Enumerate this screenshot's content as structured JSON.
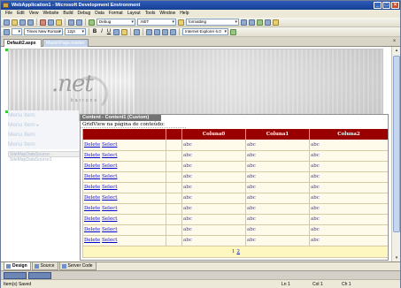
{
  "window": {
    "title": "WebApplication1 - Microsoft Development Environment"
  },
  "menu": [
    "File",
    "Edit",
    "View",
    "Website",
    "Build",
    "Debug",
    "Data",
    "Format",
    "Layout",
    "Tools",
    "Window",
    "Help"
  ],
  "toolbar": {
    "config": "Debug",
    "platform": ".NET",
    "find": "formatting",
    "font_name": "Times New Roman",
    "font_size": "12pt",
    "bold": "B",
    "italic": "I",
    "underline": "U",
    "target": "Internet Explorer 6.0"
  },
  "doc_tabs": {
    "active": "Default2.aspx",
    "inactive": "MasterPage.master"
  },
  "banner": {
    "logo": ".net",
    "logo_sub": "barrons"
  },
  "left_menu": {
    "items": [
      {
        "label": "Menu Item",
        "arrow": ""
      },
      {
        "label": "Menu Item",
        "arrow": "▸"
      },
      {
        "label": "Menu Item",
        "arrow": ""
      },
      {
        "label": "Menu Item",
        "arrow": ""
      }
    ],
    "datasource": "SiteMapDataSource - SiteMapDataSource1"
  },
  "content_panel": {
    "header": "Content - Content1 (Custom)",
    "note": "GridView na página de conteúdo:"
  },
  "grid": {
    "columns": [
      "",
      "",
      "Coluna0",
      "Coluna1",
      "Coluna2"
    ],
    "link_delete": "Delete",
    "link_select": "Select",
    "cell_value": "abc",
    "row_count": 10,
    "pager": {
      "current": "1",
      "next": "2"
    }
  },
  "view_tabs": [
    "Design",
    "Source",
    "Server Code"
  ],
  "status": {
    "left": "Item(s) Saved",
    "ln": "Ln 1",
    "col": "Col 1",
    "ch": "Ch 1"
  }
}
